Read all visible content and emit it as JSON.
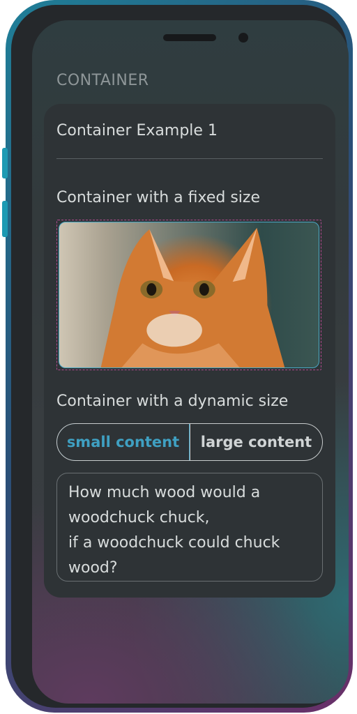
{
  "screen": {
    "section_title": "CONTAINER"
  },
  "card": {
    "title": "Container Example 1",
    "fixed_label": "Container with a fixed size",
    "dynamic_label": "Container with a dynamic size",
    "segmented": {
      "options": [
        "small content",
        "large content"
      ],
      "selected": "small content"
    },
    "text_lines": [
      "How much wood would a",
      "woodchuck chuck,",
      "if a woodchuck could chuck",
      "wood?"
    ]
  },
  "colors": {
    "accent": "#3fa0c2",
    "dashed_border": "#b04a8f",
    "card_background": "#2e3336"
  }
}
